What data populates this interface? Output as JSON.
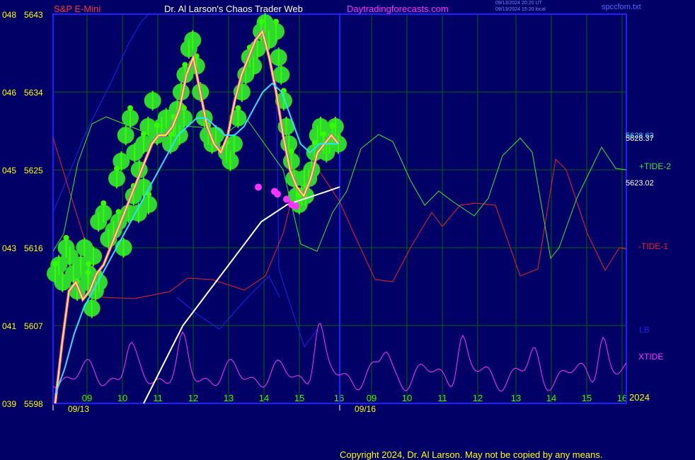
{
  "header": {
    "symbol": "S&P E-Mini",
    "title": "Dr. Al Larson's Chaos Trader Web",
    "site": "Daytradingforecasts.com",
    "timestamp_ut": "09/13/2024 20:20 UT",
    "timestamp_local": "09/13/2024 15:20 local",
    "filename": "spccfom.txt"
  },
  "footer": {
    "copyright": "Copyright 2024, Dr. Al Larson. May not be copied by any means."
  },
  "colors": {
    "background": "#000066",
    "frame": "#2020ff",
    "grid": "#006600",
    "price_bar": "#33ff00",
    "price_circle": "#2ed82e",
    "fast_avg": "#ffff00",
    "mid_avg": "#33ddff",
    "slow_avg": "#ffffff",
    "magenta": "#ff33ff",
    "tide2": "#33ee33",
    "tide1": "#ee2222",
    "lb": "#2222ee",
    "xtide": "#ff33ff"
  },
  "chart_data": {
    "type": "line",
    "y_axis": {
      "range": [
        5598,
        5643
      ],
      "ticks": [
        {
          "left": "048",
          "price": "5643"
        },
        {
          "left": "046",
          "price": "5634"
        },
        {
          "left": "045",
          "price": "5625"
        },
        {
          "left": "043",
          "price": "5616"
        },
        {
          "left": "041",
          "price": "5607"
        },
        {
          "left": "039",
          "price": "5598"
        }
      ]
    },
    "x_axis": {
      "hour_labels": [
        "09",
        "10",
        "11",
        "12",
        "13",
        "14",
        "15",
        "16",
        "09",
        "10",
        "11",
        "12",
        "13",
        "14",
        "15",
        "16"
      ],
      "date_labels": [
        "09/13",
        "09/16"
      ],
      "year_label": "2024"
    },
    "price_labels": [
      "5628.63",
      "5628.37",
      "5623.02"
    ],
    "series_labels": [
      "+TIDE-2",
      "-TIDE-1",
      "LB",
      "XTIDE"
    ],
    "price_bars": [
      {
        "v": [
          5613,
          5614,
          5612,
          5616,
          5615,
          5613,
          5611,
          5614,
          5616,
          5612,
          5609,
          5611,
          5612
        ]
      },
      {
        "v": [
          5613,
          5615,
          5619,
          5620,
          5617,
          5618,
          5619,
          5616,
          5620,
          5622,
          5620,
          5623,
          5621
        ]
      },
      {
        "v": [
          5624,
          5626,
          5629,
          5631,
          5627,
          5625,
          5628,
          5630,
          5633,
          5629,
          5630,
          5631,
          5628,
          5630,
          5629,
          5631
        ]
      },
      {
        "v": [
          5630,
          5632,
          5634,
          5636,
          5639,
          5640,
          5637,
          5634,
          5631,
          5629,
          5628,
          5629
        ]
      },
      {
        "v": [
          5627,
          5626,
          5628,
          5631,
          5634,
          5636,
          5638,
          5637,
          5639,
          5641,
          5642,
          5640
        ]
      },
      {
        "v": [
          5641,
          5638,
          5636,
          5633,
          5630,
          5628,
          5626,
          5624,
          5622,
          5621,
          5622,
          5624
        ]
      },
      {
        "v": [
          5622,
          5624,
          5625,
          5627,
          5629,
          5630,
          5628,
          5627,
          5628,
          5629,
          5630,
          5628
        ]
      }
    ],
    "fast_avg": [
      5598,
      5605,
      5611,
      5612,
      5610,
      5611,
      5613,
      5614,
      5616,
      5618,
      5620,
      5622,
      5624,
      5626,
      5628,
      5629,
      5629,
      5630,
      5632,
      5636,
      5638,
      5634,
      5630,
      5628,
      5627,
      5629,
      5633,
      5636,
      5638,
      5640,
      5641,
      5638,
      5634,
      5629,
      5625,
      5623,
      5622,
      5624,
      5627,
      5628,
      5629,
      5628
    ],
    "mid_avg": [
      5599,
      5602,
      5606,
      5609,
      5611,
      5613,
      5615,
      5617,
      5619,
      5621,
      5623,
      5625,
      5627,
      5629,
      5630,
      5631,
      5631,
      5630,
      5629,
      5629,
      5630,
      5632,
      5634,
      5635,
      5634,
      5631,
      5628,
      5627,
      5628,
      5628,
      5628
    ],
    "slow_avg": [
      5598,
      5601,
      5604,
      5607,
      5609,
      5611,
      5613,
      5615,
      5617,
      5619,
      5620,
      5621,
      5621.5,
      5622,
      5622.5,
      5623.02
    ],
    "magenta_dots": [
      5623,
      5622.5,
      5622.2,
      5621.6,
      5621,
      5620.8
    ]
  }
}
